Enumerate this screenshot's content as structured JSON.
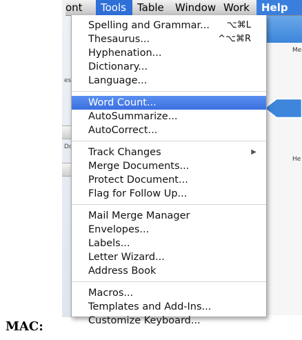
{
  "menubar": {
    "items": [
      {
        "label": "ont"
      },
      {
        "label": "Tools"
      },
      {
        "label": "Table"
      },
      {
        "label": "Window"
      },
      {
        "label": "Work"
      },
      {
        "label": "Help"
      }
    ]
  },
  "menu": {
    "groups": [
      [
        {
          "label": "Spelling and Grammar...",
          "shortcut": "⌥⌘L"
        },
        {
          "label": "Thesaurus...",
          "shortcut": "^⌥⌘R"
        },
        {
          "label": "Hyphenation..."
        },
        {
          "label": "Dictionary..."
        },
        {
          "label": "Language..."
        }
      ],
      [
        {
          "label": "Word Count...",
          "highlighted": true
        },
        {
          "label": "AutoSummarize..."
        },
        {
          "label": "AutoCorrect..."
        }
      ],
      [
        {
          "label": "Track Changes",
          "submenu": true
        },
        {
          "label": "Merge Documents..."
        },
        {
          "label": "Protect Document..."
        },
        {
          "label": "Flag for Follow Up..."
        }
      ],
      [
        {
          "label": "Mail Merge Manager"
        },
        {
          "label": "Envelopes..."
        },
        {
          "label": "Labels..."
        },
        {
          "label": "Letter Wizard..."
        },
        {
          "label": "Address Book"
        }
      ],
      [
        {
          "label": "Macros..."
        },
        {
          "label": "Templates and Add-Ins..."
        },
        {
          "label": "Customize Keyboard..."
        }
      ]
    ]
  },
  "dialog": {
    "labels": [
      "Me",
      "He"
    ]
  },
  "background": {
    "labels": [
      "es",
      "Do"
    ]
  },
  "mac_label": "MAC:",
  "colors": {
    "highlight": "#3a6fe0",
    "menubar_active": "#2f6fd8",
    "callout": "#3d86db"
  }
}
